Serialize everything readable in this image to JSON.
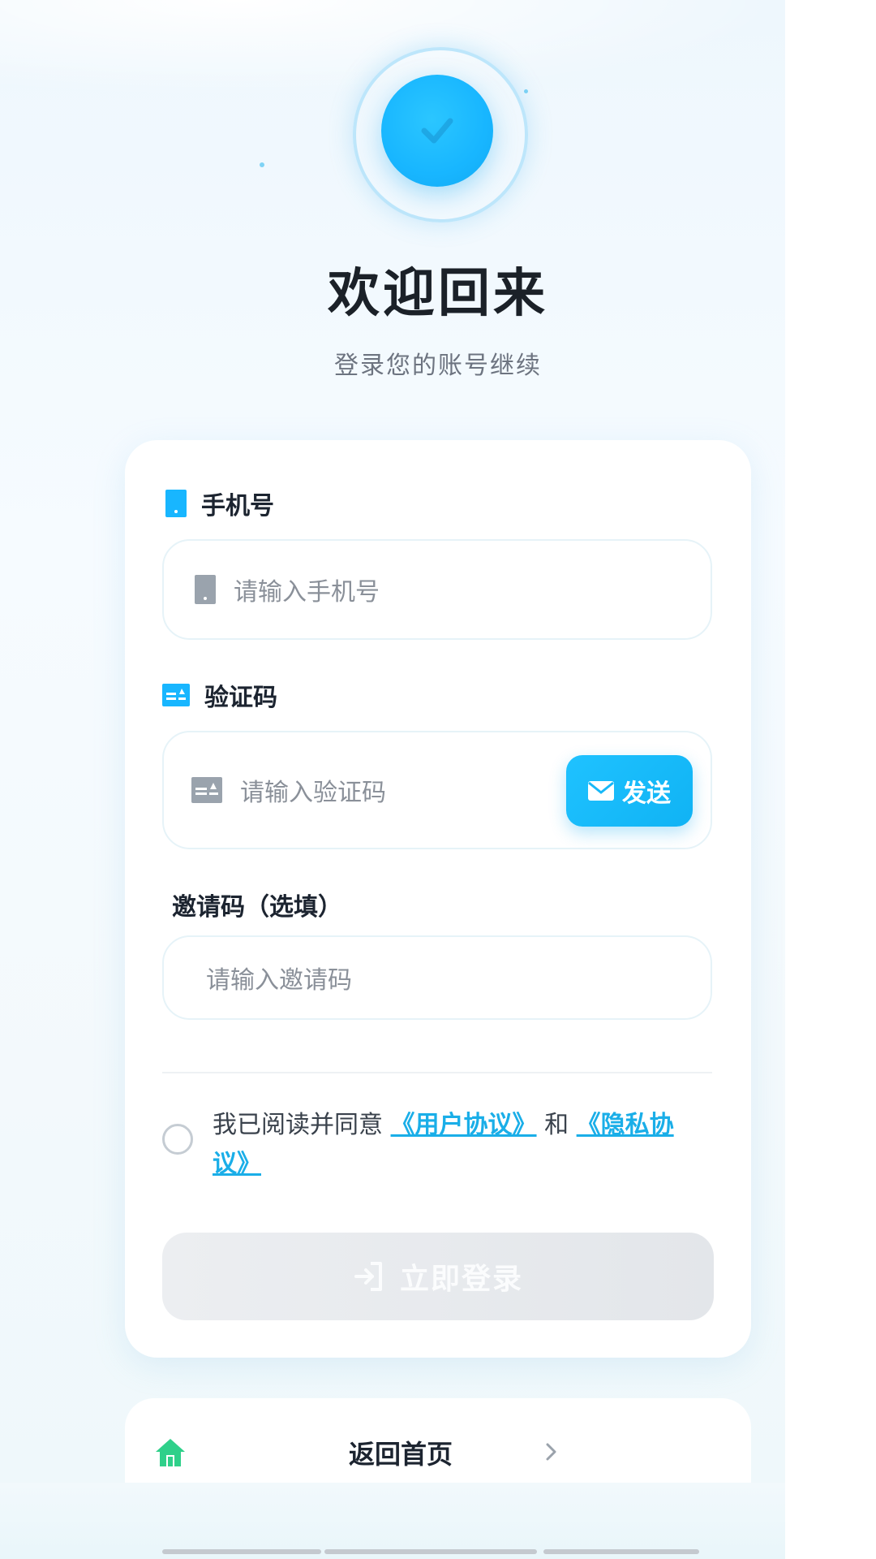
{
  "header": {
    "title": "欢迎回来",
    "subtitle": "登录您的账号继续"
  },
  "form": {
    "phone": {
      "label": "手机号",
      "placeholder": "请输入手机号",
      "icon": "phone-icon"
    },
    "code": {
      "label": "验证码",
      "placeholder": "请输入验证码",
      "icon": "id-card-icon",
      "send_label": "发送",
      "send_icon": "mail-icon"
    },
    "invite": {
      "label": "邀请码（选填）",
      "placeholder": "请输入邀请码"
    },
    "agreement": {
      "prefix": "我已阅读并同意",
      "user_agreement": "《用户协议》",
      "and": "和",
      "privacy_policy": "《隐私协议》"
    },
    "login_label": "立即登录",
    "login_icon": "login-icon"
  },
  "footer": {
    "home_label": "返回首页",
    "home_icon": "home-icon",
    "chevron_icon": "chevron-right-icon"
  },
  "colors": {
    "accent": "#18b6ff",
    "link": "#1aaee8",
    "home_icon": "#2fd08a",
    "disabled_button": "#e6e8eb"
  }
}
